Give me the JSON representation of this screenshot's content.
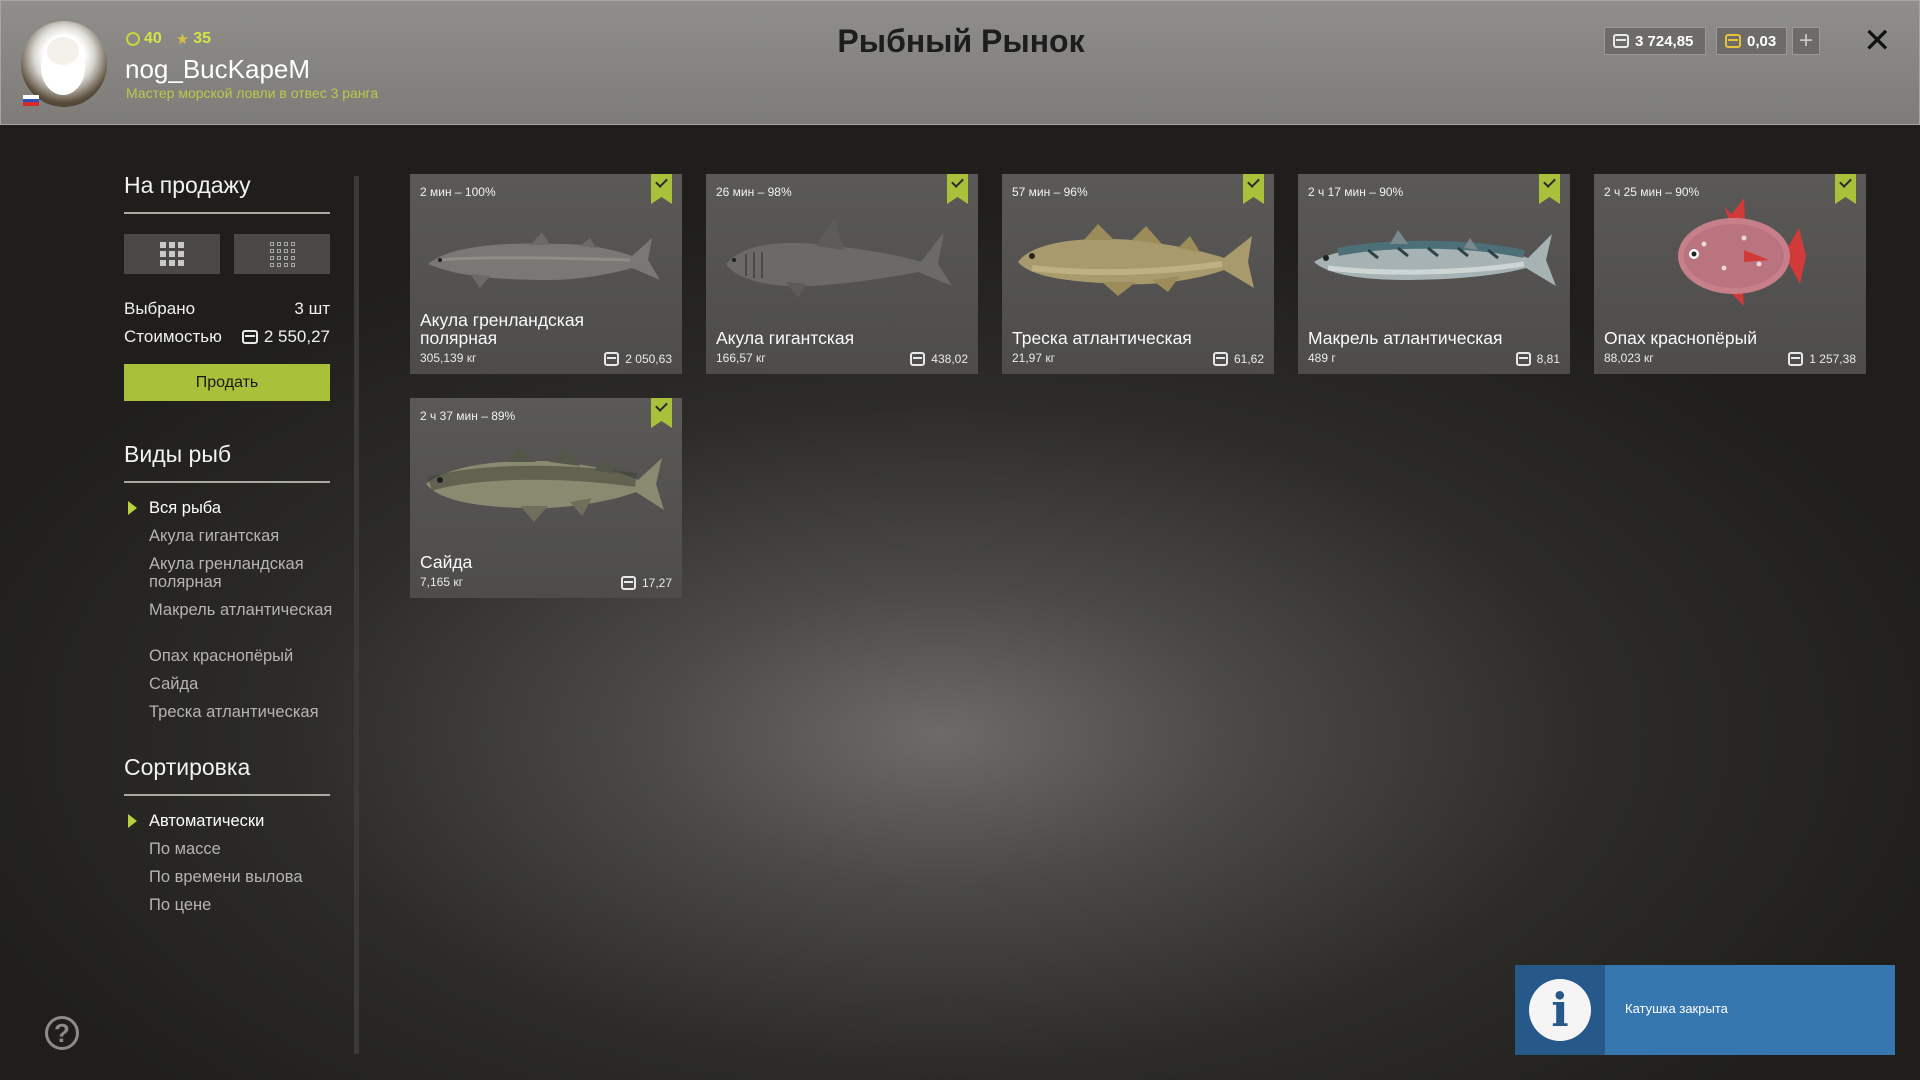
{
  "header": {
    "title": "Рыбный Рынок",
    "level": "40",
    "stars": "35",
    "username": "nog_BucKapeM",
    "rank": "Мастер морской ловли в отвес 3 ранга",
    "silver": "3 724,85",
    "gold": "0,03",
    "add_label": "+",
    "close_label": "✕"
  },
  "sale": {
    "title": "На продажу",
    "selected_label": "Выбрано",
    "selected_value": "3 шт",
    "cost_label": "Стоимостью",
    "cost_value": "2 550,27",
    "sell_label": "Продать"
  },
  "species": {
    "title": "Виды рыб",
    "items": [
      "Вся рыба",
      "Акула гигантская",
      "Акула гренландская полярная",
      "Макрель атлантическая",
      "Опах краснопёрый",
      "Сайда",
      "Треска атлантическая"
    ]
  },
  "sort": {
    "title": "Сортировка",
    "items": [
      "Автоматически",
      "По массе",
      "По времени вылова",
      "По цене"
    ]
  },
  "cards": [
    {
      "time": "2 мин – 100%",
      "name": "Акула гренландская полярная",
      "weight": "305,139 кг",
      "price": "2 050,63",
      "icon": "greenland-shark"
    },
    {
      "time": "26 мин – 98%",
      "name": "Акула гигантская",
      "weight": "166,57 кг",
      "price": "438,02",
      "icon": "basking-shark"
    },
    {
      "time": "57 мин – 96%",
      "name": "Треска атлантическая",
      "weight": "21,97 кг",
      "price": "61,62",
      "icon": "atlantic-cod"
    },
    {
      "time": "2 ч 17 мин – 90%",
      "name": "Макрель атлантическая",
      "weight": "489 г",
      "price": "8,81",
      "icon": "atlantic-mackerel"
    },
    {
      "time": "2 ч 25 мин – 90%",
      "name": "Опах краснопёрый",
      "weight": "88,023 кг",
      "price": "1 257,38",
      "icon": "opah"
    },
    {
      "time": "2 ч 37 мин – 89%",
      "name": "Сайда",
      "weight": "7,165 кг",
      "price": "17,27",
      "icon": "pollock"
    }
  ],
  "notification": {
    "message": "Катушка закрыта",
    "icon": "info-icon"
  },
  "help_label": "?",
  "colors": {
    "accent": "#a9c03a",
    "notify": "#3677b0"
  }
}
